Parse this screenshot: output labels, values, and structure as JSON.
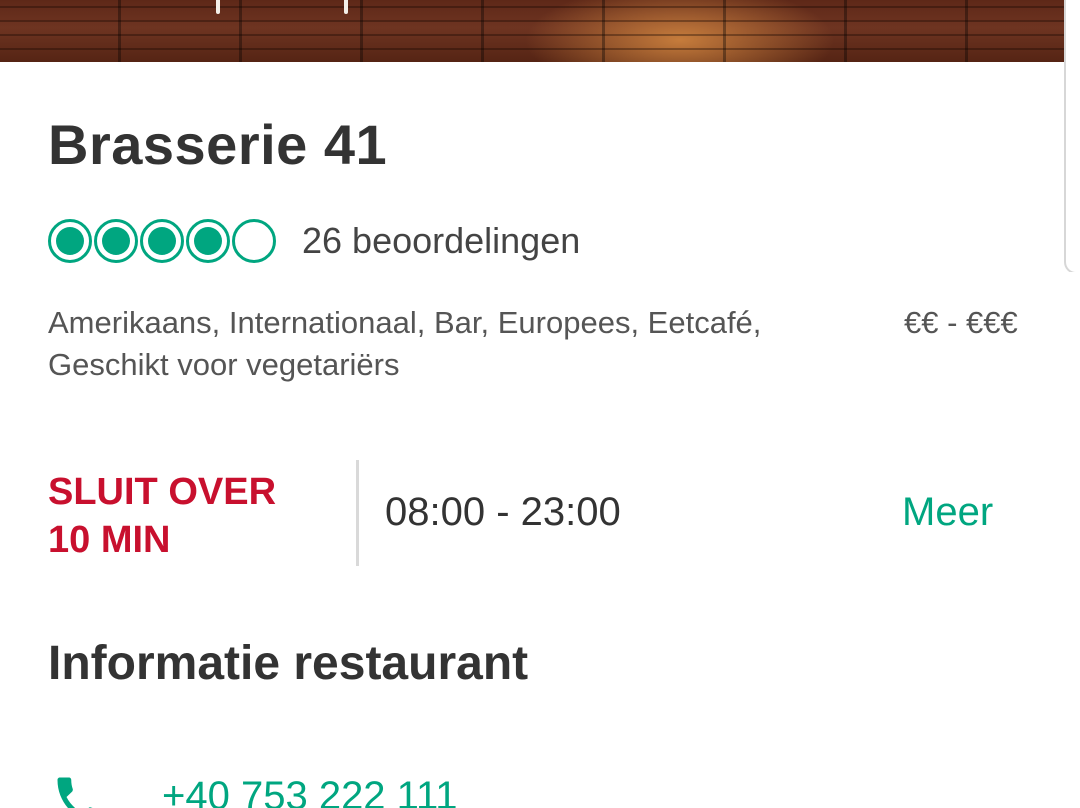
{
  "restaurant": {
    "name": "Brasserie 41",
    "rating": 4,
    "rating_max": 5,
    "review_count_label": "26 beoordelingen",
    "cuisines": "Amerikaans, Internationaal, Bar, Europees, Eetcafé, Geschikt voor vegetariërs",
    "price_range": "€€ - €€€"
  },
  "hours": {
    "status_line1": "SLUIT OVER",
    "status_line2": "10 MIN",
    "today": "08:00 - 23:00",
    "more_label": "Meer"
  },
  "info": {
    "section_title": "Informatie restaurant",
    "phone": "+40 753 222 111",
    "phone_icon": "phone-icon"
  },
  "colors": {
    "accent_green": "#00a680",
    "closing_red": "#c8102e",
    "text_dark": "#333333"
  }
}
